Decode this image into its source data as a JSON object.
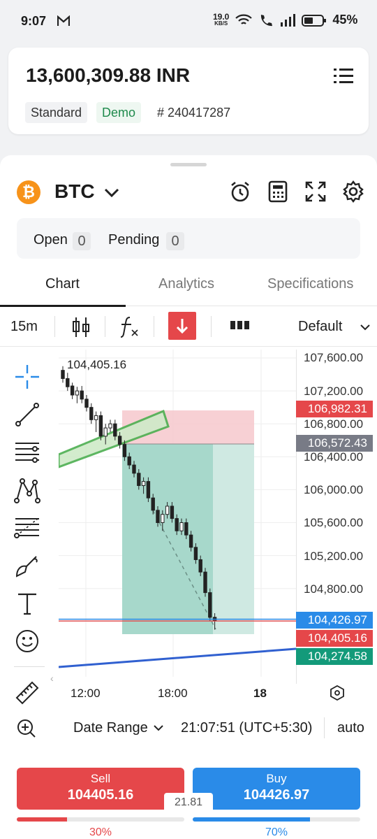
{
  "status_bar": {
    "time": "9:07",
    "speed": "19.0",
    "speed_unit": "KB/S",
    "battery": "45%"
  },
  "account": {
    "balance": "13,600,309.88 INR",
    "type": "Standard",
    "mode": "Demo",
    "number": "# 240417287"
  },
  "instrument": {
    "symbol": "BTC"
  },
  "order_tabs": [
    {
      "label": "Open",
      "count": "0"
    },
    {
      "label": "Pending",
      "count": "0"
    }
  ],
  "main_tabs": [
    "Chart",
    "Analytics",
    "Specifications"
  ],
  "toolbar": {
    "timeframe": "15m",
    "layout": "Default"
  },
  "chart": {
    "top_price": "104,405.16",
    "y_ticks": [
      "107,600.00",
      "107,200.00",
      "106,800.00",
      "106,400.00",
      "106,000.00",
      "105,600.00",
      "105,200.00",
      "104,800.00"
    ],
    "x_ticks": [
      "12:00",
      "18:00",
      "18"
    ],
    "price_labels": [
      {
        "text": "106,982.31",
        "color": "#e5474a"
      },
      {
        "text": "106,572.43",
        "color": "#787b86"
      },
      {
        "text": "104,426.97",
        "color": "#2a8be8"
      },
      {
        "text": "104,405.16",
        "color": "#e5474a"
      },
      {
        "text": "104,274.58",
        "color": "#139a7a"
      }
    ]
  },
  "bottom_bar": {
    "date_range": "Date Range",
    "clock": "21:07:51 (UTC+5:30)",
    "scale": "auto"
  },
  "trade": {
    "sell_label": "Sell",
    "sell_price": "104405.16",
    "buy_label": "Buy",
    "buy_price": "104426.97",
    "spread": "21.81",
    "sell_pct": "30%",
    "buy_pct": "70%",
    "sell_fraction": 0.3,
    "buy_fraction": 0.7
  },
  "colors": {
    "sell": "#e5474a",
    "buy": "#2a8be8",
    "accent": "#2a8be8",
    "btc": "#f7931a"
  },
  "icons": [
    "alarm-icon",
    "calculator-icon",
    "fullscreen-icon",
    "settings-icon",
    "crosshair-icon",
    "trendline-icon",
    "horizontal-lines-icon",
    "pattern-icon",
    "fib-icon",
    "brush-icon",
    "text-icon",
    "emoji-icon",
    "ruler-icon",
    "zoom-in-icon",
    "magnet-icon"
  ]
}
